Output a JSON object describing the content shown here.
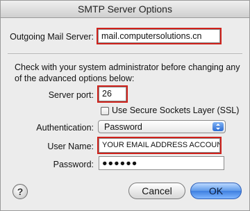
{
  "dialog": {
    "title": "SMTP Server Options"
  },
  "outgoing": {
    "label": "Outgoing Mail Server:",
    "value": "mail.computersolutions.cn"
  },
  "instructions": "Check with your system administrator before changing any of the advanced options below:",
  "server_port": {
    "label": "Server port:",
    "value": "26"
  },
  "ssl": {
    "label": "Use Secure Sockets Layer (SSL)",
    "checked": false
  },
  "authentication": {
    "label": "Authentication:",
    "selected": "Password"
  },
  "username": {
    "label": "User Name:",
    "value": "YOUR EMAIL ADDRESS ACCOUNT"
  },
  "password": {
    "label": "Password:",
    "masked_value": "●●●●●●"
  },
  "buttons": {
    "help": "?",
    "cancel": "Cancel",
    "ok": "OK"
  },
  "colors": {
    "highlight": "#d0211b",
    "accent": "#3f7fe0"
  }
}
